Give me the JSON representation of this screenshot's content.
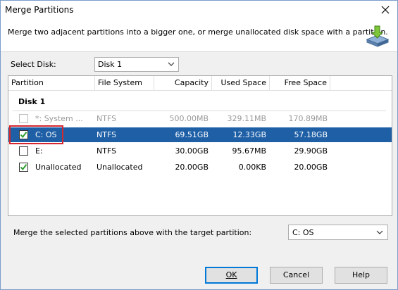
{
  "window": {
    "title": "Merge Partitions"
  },
  "header": {
    "description": "Merge two adjacent partitions into a bigger one, or merge unallocated disk space with a partition."
  },
  "disk_select": {
    "label": "Select Disk:",
    "value": "Disk 1"
  },
  "columns": {
    "partition": "Partition",
    "file_system": "File System",
    "capacity": "Capacity",
    "used_space": "Used Space",
    "free_space": "Free Space"
  },
  "group": {
    "title": "Disk 1"
  },
  "rows": [
    {
      "checked": false,
      "disabled": true,
      "selected": false,
      "partition": "*: System ...",
      "file_system": "NTFS",
      "capacity": "500.00MB",
      "used_space": "329.11MB",
      "free_space": "170.89MB"
    },
    {
      "checked": true,
      "disabled": false,
      "selected": true,
      "partition": "C:  OS",
      "file_system": "NTFS",
      "capacity": "69.51GB",
      "used_space": "12.33GB",
      "free_space": "57.18GB"
    },
    {
      "checked": false,
      "disabled": false,
      "selected": false,
      "partition": "E:",
      "file_system": "NTFS",
      "capacity": "30.00GB",
      "used_space": "95.67MB",
      "free_space": "29.90GB"
    },
    {
      "checked": true,
      "disabled": false,
      "selected": false,
      "partition": "Unallocated",
      "file_system": "Unallocated",
      "capacity": "20.00GB",
      "used_space": "0.00KB",
      "free_space": "20.00GB"
    }
  ],
  "target": {
    "label": "Merge the selected partitions above with the target partition:",
    "value": "C:  OS"
  },
  "buttons": {
    "ok": "OK",
    "cancel": "Cancel",
    "help": "Help"
  },
  "colors": {
    "selection": "#1e5fa6",
    "highlight": "#d6262f",
    "check": "#2e9e2e"
  }
}
